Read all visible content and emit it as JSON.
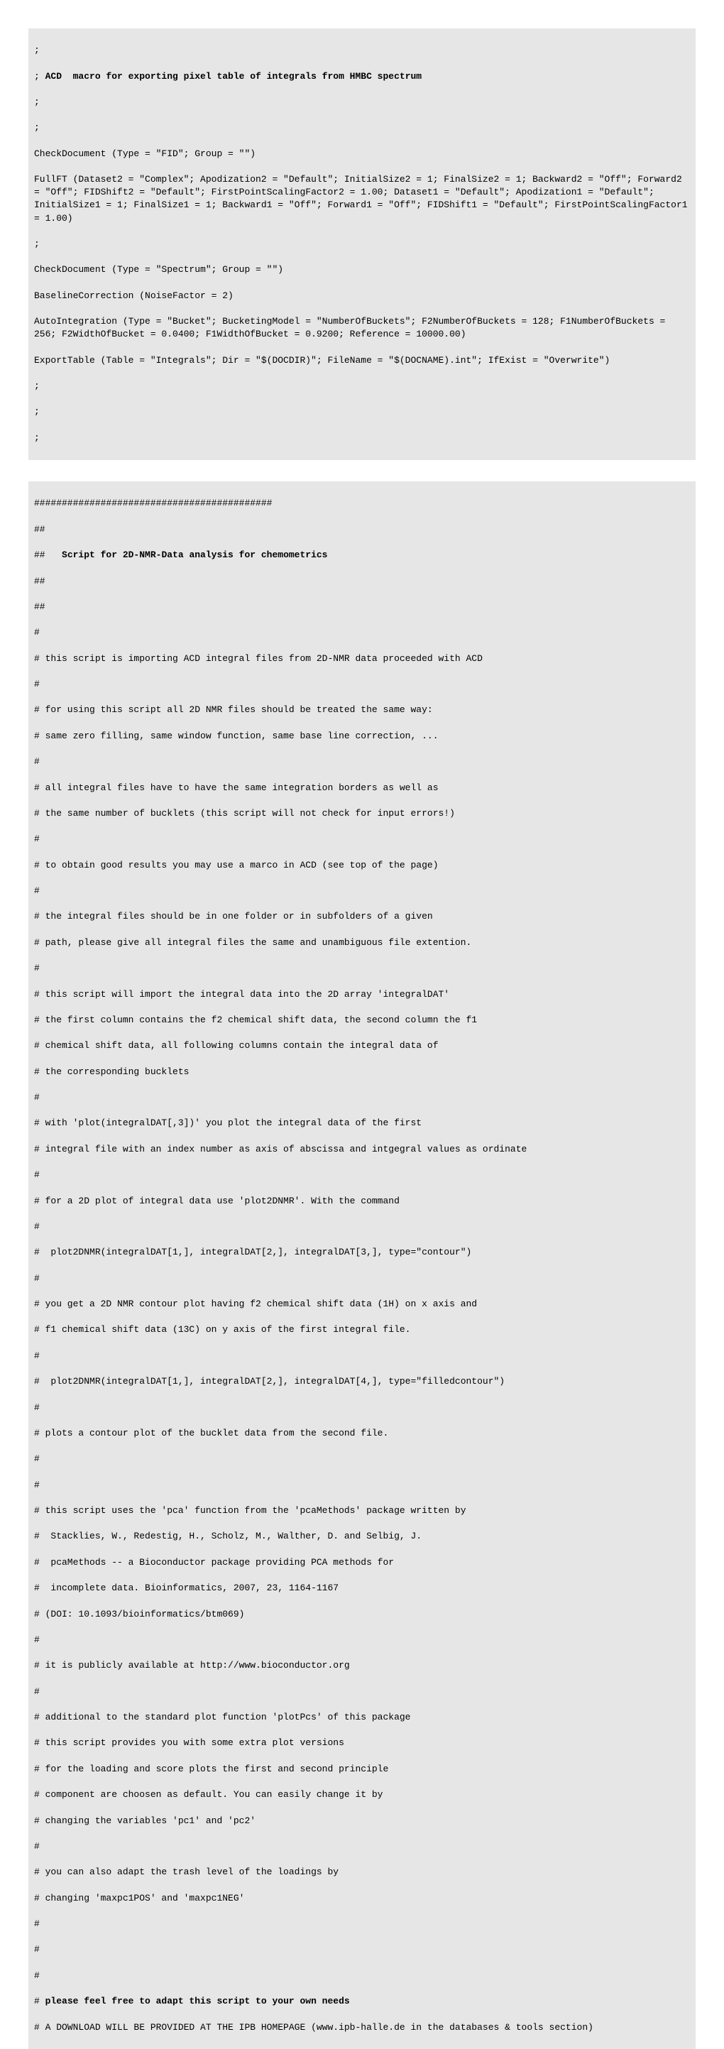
{
  "block1": {
    "l1": ";",
    "l2": "; ACD  macro for exporting pixel table of integrals from HMBC spectrum",
    "l3": ";",
    "l4": ";",
    "l5": "CheckDocument (Type = \"FID\"; Group = \"\")",
    "l6": "FullFT (Dataset2 = \"Complex\"; Apodization2 = \"Default\"; InitialSize2 = 1; FinalSize2 = 1; Backward2 = \"Off\"; Forward2 = \"Off\"; FIDShift2 = \"Default\"; FirstPointScalingFactor2 = 1.00; Dataset1 = \"Default\"; Apodization1 = \"Default\"; InitialSize1 = 1; FinalSize1 = 1; Backward1 = \"Off\"; Forward1 = \"Off\"; FIDShift1 = \"Default\"; FirstPointScalingFactor1 = 1.00)",
    "l7": ";",
    "l8": "CheckDocument (Type = \"Spectrum\"; Group = \"\")",
    "l9": "BaselineCorrection (NoiseFactor = 2)",
    "l10": "AutoIntegration (Type = \"Bucket\"; BucketingModel = \"NumberOfBuckets\"; F2NumberOfBuckets = 128; F1NumberOfBuckets = 256; F2WidthOfBucket = 0.0400; F1WidthOfBucket = 0.9200; Reference = 10000.00)",
    "l11": "ExportTable (Table = \"Integrals\"; Dir = \"$(DOCDIR)\"; FileName = \"$(DOCNAME).int\"; IfExist = \"Overwrite\")",
    "l12": ";",
    "l13": ";",
    "l14": ";"
  },
  "block2": {
    "l1": "###########################################",
    "l2": "##",
    "l3": "##   Script for 2D-NMR-Data analysis for chemometrics",
    "l4": "##",
    "l5": "##",
    "l6": "#",
    "l7": "# this script is importing ACD integral files from 2D-NMR data proceeded with ACD",
    "l8": "#",
    "l9": "# for using this script all 2D NMR files should be treated the same way:",
    "l10": "# same zero filling, same window function, same base line correction, ...",
    "l11": "#",
    "l12": "# all integral files have to have the same integration borders as well as",
    "l13": "# the same number of bucklets (this script will not check for input errors!)",
    "l14": "#",
    "l15": "# to obtain good results you may use a marco in ACD (see top of the page)",
    "l16": "#",
    "l17": "# the integral files should be in one folder or in subfolders of a given",
    "l18": "# path, please give all integral files the same and unambiguous file extention.",
    "l19": "#",
    "l20": "# this script will import the integral data into the 2D array 'integralDAT'",
    "l21": "# the first column contains the f2 chemical shift data, the second column the f1",
    "l22": "# chemical shift data, all following columns contain the integral data of",
    "l23": "# the corresponding bucklets",
    "l24": "#",
    "l25": "# with 'plot(integralDAT[,3])' you plot the integral data of the first",
    "l26": "# integral file with an index number as axis of abscissa and intgegral values as ordinate",
    "l27": "#",
    "l28": "# for a 2D plot of integral data use 'plot2DNMR'. With the command",
    "l29": "#",
    "l30": "#  plot2DNMR(integralDAT[1,], integralDAT[2,], integralDAT[3,], type=\"contour\")",
    "l31": "#",
    "l32": "# you get a 2D NMR contour plot having f2 chemical shift data (1H) on x axis and",
    "l33": "# f1 chemical shift data (13C) on y axis of the first integral file.",
    "l34": "#",
    "l35": "#  plot2DNMR(integralDAT[1,], integralDAT[2,], integralDAT[4,], type=\"filledcontour\")",
    "l36": "#",
    "l37": "# plots a contour plot of the bucklet data from the second file.",
    "l38": "#",
    "l39": "#",
    "l40": "# this script uses the 'pca' function from the 'pcaMethods' package written by",
    "l41": "#  Stacklies, W., Redestig, H., Scholz, M., Walther, D. and Selbig, J.",
    "l42": "#  pcaMethods -- a Bioconductor package providing PCA methods for",
    "l43": "#  incomplete data. Bioinformatics, 2007, 23, 1164-1167",
    "l44": "# (DOI: 10.1093/bioinformatics/btm069)",
    "l45": "#",
    "l46": "# it is publicly available at http://www.bioconductor.org",
    "l47": "#",
    "l48": "# additional to the standard plot function 'plotPcs' of this package",
    "l49": "# this script provides you with some extra plot versions",
    "l50": "# for the loading and score plots the first and second principle",
    "l51": "# component are choosen as default. You can easily change it by",
    "l52": "# changing the variables 'pc1' and 'pc2'",
    "l53": "#",
    "l54": "# you can also adapt the trash level of the loadings by",
    "l55": "# changing 'maxpc1POS' and 'maxpc1NEG'",
    "l56": "#",
    "l57": "#",
    "l58": "#",
    "l59": "# please feel free to adapt this script to your own needs",
    "l60": "# A DOWNLOAD WILL BE PROVIDED AT THE IPB HOMEPAGE (www.ipb-halle.de in the databases & tools section)"
  }
}
